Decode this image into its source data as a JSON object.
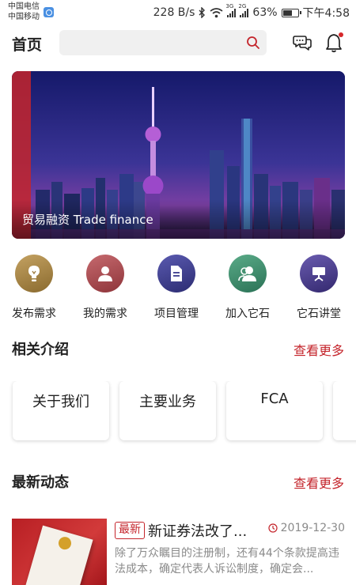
{
  "status_bar": {
    "carrier_1": "中国电信",
    "carrier_2": "中国移动",
    "speed": "228 B/s",
    "network_1": "3G",
    "network_2": "2G",
    "battery": "63%",
    "battery_level": 0.63,
    "time": "下午4:58"
  },
  "header": {
    "title": "首页",
    "search_placeholder": "",
    "icons": [
      "search-icon",
      "chat-icon",
      "bell-icon"
    ],
    "notification_dot": true
  },
  "banner": {
    "caption": "贸易融资 Trade finance"
  },
  "quick_actions": [
    {
      "label": "发布需求",
      "icon": "lightbulb-icon",
      "color": "#9c7a3c"
    },
    {
      "label": "我的需求",
      "icon": "user-icon",
      "color": "#a94a4f"
    },
    {
      "label": "项目管理",
      "icon": "document-icon",
      "color": "#3f3f8f"
    },
    {
      "label": "加入它石",
      "icon": "group-icon",
      "color": "#3d8f6e"
    },
    {
      "label": "它石讲堂",
      "icon": "lectern-icon",
      "color": "#4b3f8f"
    }
  ],
  "intro": {
    "title": "相关介绍",
    "more": "查看更多",
    "cards": [
      "关于我们",
      "主要业务",
      "FCA"
    ]
  },
  "news": {
    "title": "最新动态",
    "more": "查看更多",
    "items": [
      {
        "badge": "最新",
        "headline": "新证券法改了...",
        "date": "2019-12-30",
        "summary": "除了万众瞩目的注册制，还有44个条款提高违法成本，确定代表人诉讼制度，确定会..."
      }
    ]
  },
  "colors": {
    "accent": "#c4242b"
  }
}
